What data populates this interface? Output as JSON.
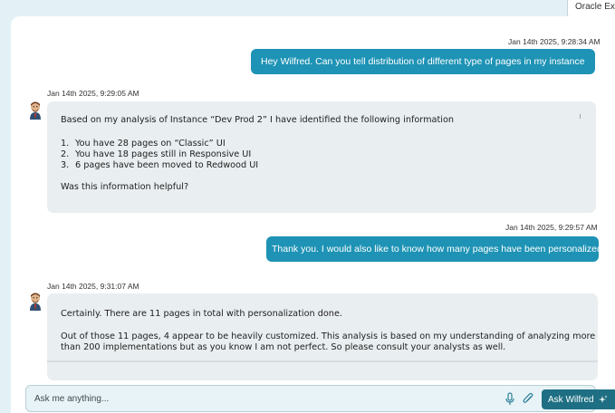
{
  "top_chip": {
    "label": "Oracle Expe"
  },
  "messages": [
    {
      "role": "user",
      "timestamp": "Jan 14th 2025, 9:28:34 AM",
      "text": "Hey Wilfred. Can you tell distribution of different type of pages in my instance"
    },
    {
      "role": "bot",
      "timestamp": "Jan 14th 2025, 9:29:05 AM",
      "intro": "Based on my analysis of Instance “Dev Prod 2” I have identified the following information",
      "items": [
        {
          "num": "1.",
          "text": "You have 28 pages on “Classic” UI"
        },
        {
          "num": "2.",
          "text": "You have 18 pages still in Responsive UI"
        },
        {
          "num": "3.",
          "text": "6 pages have been moved to Redwood UI"
        }
      ],
      "outro": "Was this information helpful?"
    },
    {
      "role": "user",
      "timestamp": "Jan 14th 2025, 9:29:57 AM",
      "text": "Thank you. I would also like to know how many pages have been personalized"
    },
    {
      "role": "bot",
      "timestamp": "Jan 14th 2025, 9:31:07 AM",
      "line1": "Certainly. There are 11 pages in total with personalization done.",
      "line2": "Out of those 11 pages, 4 appear to be heavily customized.  This analysis is based on my understanding of analyzing more",
      "line3": "than 200 implementations but as you know I am not perfect. So please consult your analysts as well."
    }
  ],
  "composer": {
    "placeholder": "Ask me anything...",
    "ask_button_label": "Ask Wilfred",
    "icons": [
      "microphone-icon",
      "paperclip-icon",
      "sparkle-icon"
    ]
  },
  "colors": {
    "user_bubble": "#1e93b5",
    "bot_bubble": "#e9eef0",
    "ask_button": "#1e6f83",
    "background": "#e3f1f7"
  }
}
